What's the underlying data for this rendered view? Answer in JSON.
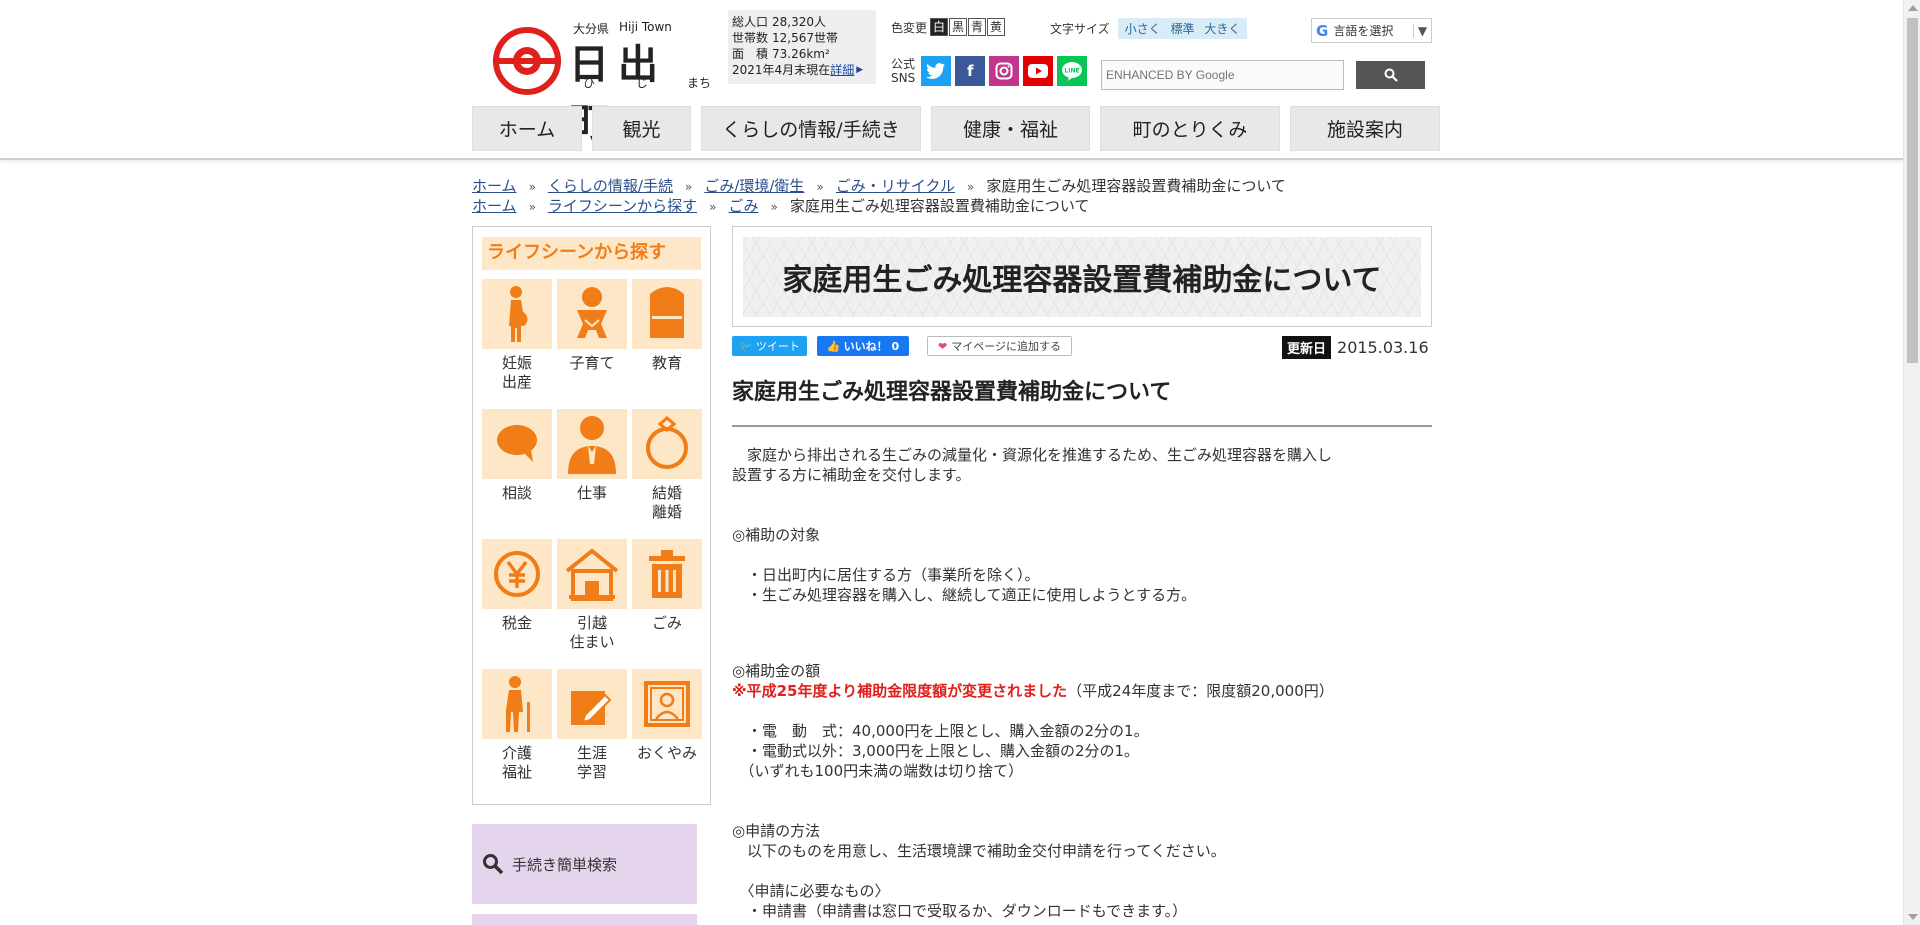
{
  "header": {
    "pref": "大分県",
    "town_en": "Hiji Town",
    "town_ja": "日出町",
    "ruby": [
      "ひ",
      "じ",
      "まち"
    ],
    "stats": {
      "rows": [
        {
          "k": "総人口",
          "v": "28,320人"
        },
        {
          "k": "世帯数",
          "v": "12,567世帯"
        },
        {
          "k": "面　積",
          "v": "73.26km²"
        }
      ],
      "asof": "2021年4月末現在",
      "detail_link": "詳細"
    },
    "color_change": {
      "label": "色変更",
      "options": [
        "白",
        "黒",
        "青",
        "黄"
      ]
    },
    "font_size": {
      "label": "文字サイズ",
      "options": [
        "小さく",
        "標準",
        "大きく"
      ]
    },
    "translate": {
      "label": "言語を選択"
    },
    "sns_label_line1": "公式",
    "sns_label_line2": "SNS",
    "sns": [
      "twitter-icon",
      "facebook-icon",
      "instagram-icon",
      "youtube-icon",
      "line-icon"
    ],
    "search_placeholder": "ENHANCED BY Google"
  },
  "nav": {
    "items": [
      "ホーム",
      "観光",
      "くらしの情報/手続き",
      "健康・福祉",
      "町のとりくみ",
      "施設案内"
    ]
  },
  "breadcrumb1": [
    "ホーム",
    "くらしの情報/手続",
    "ごみ/環境/衛生",
    "ごみ・リサイクル",
    "家庭用生ごみ処理容器設置費補助金について"
  ],
  "breadcrumb2": [
    "ホーム",
    "ライフシーンから探す",
    "ごみ",
    "家庭用生ごみ処理容器設置費補助金について"
  ],
  "sidebar": {
    "title": "ライフシーンから探す",
    "items": [
      {
        "l1": "妊娠",
        "l2": "出産",
        "icon": "pregnancy-icon"
      },
      {
        "l1": "子育て",
        "l2": "",
        "icon": "baby-icon"
      },
      {
        "l1": "教育",
        "l2": "",
        "icon": "school-bag-icon"
      },
      {
        "l1": "相談",
        "l2": "",
        "icon": "speech-bubble-icon"
      },
      {
        "l1": "仕事",
        "l2": "",
        "icon": "businessman-icon"
      },
      {
        "l1": "結婚",
        "l2": "離婚",
        "icon": "ring-icon"
      },
      {
        "l1": "税金",
        "l2": "",
        "icon": "yen-icon"
      },
      {
        "l1": "引越",
        "l2": "住まい",
        "icon": "house-icon"
      },
      {
        "l1": "ごみ",
        "l2": "",
        "icon": "trash-icon"
      },
      {
        "l1": "介護",
        "l2": "福祉",
        "icon": "elderly-icon"
      },
      {
        "l1": "生涯",
        "l2": "学習",
        "icon": "pencil-icon"
      },
      {
        "l1": "おくやみ",
        "l2": "",
        "icon": "portrait-icon"
      }
    ],
    "proc_search": "手続き簡単検索"
  },
  "article": {
    "title": "家庭用生ごみ処理容器設置費補助金について",
    "tweet": "ツイート",
    "like": "いいね！ 0",
    "mypage": "マイページに追加する",
    "updated_label": "更新日",
    "updated_date": "2015.03.16",
    "heading": "家庭用生ごみ処理容器設置費補助金について",
    "p1a": "　家庭から排出される生ごみの減量化・資源化を推進するため、生ごみ処理容器を購入し",
    "p1b": "設置する方に補助金を交付します。",
    "s1": "◎補助の対象",
    "s1a": "　・日出町内に居住する方（事業所を除く）。",
    "s1b": "　・生ごみ処理容器を購入し、継続して適正に使用しようとする方。",
    "s2": "◎補助金の額",
    "s2_red": "※平成25年度より補助金限度額が変更されました",
    "s2_note": "（平成24年度まで：限度額20,000円）",
    "s2a": "　・電　動　式：40,000円を上限とし、購入金額の2分の1。",
    "s2b": "　・電動式以外：3,000円を上限とし、購入金額の2分の1。",
    "s2c": "　（いずれも100円未満の端数は切り捨て）",
    "s3": "◎申請の方法",
    "s3a": "　以下のものを用意し、生活環境課で補助金交付申請を行ってください。",
    "s3b": "　〈申請に必要なもの〉",
    "s3c": "　・申請書（申請書は窓口で受取るか、ダウンロードもできます。）"
  },
  "colors": {
    "orange": "#f07d17",
    "tile": "#fde7c7",
    "purple": "#e5d5ec",
    "red": "#e0211b"
  }
}
